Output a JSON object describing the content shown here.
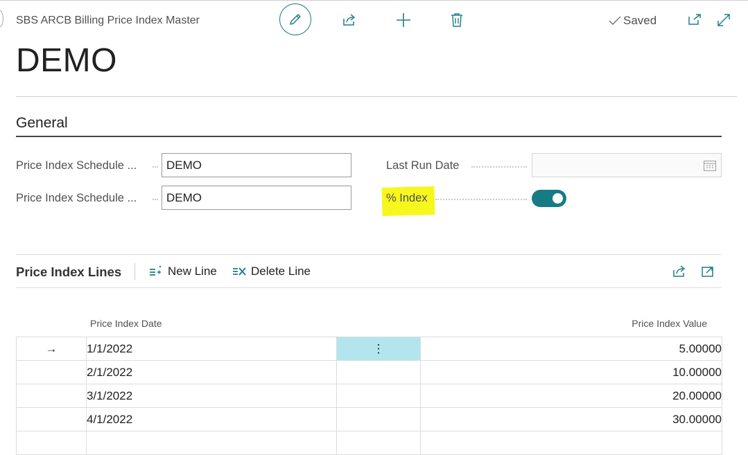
{
  "header": {
    "page_caption": "SBS ARCB Billing Price Index Master",
    "saved_label": "Saved",
    "record_title": "DEMO"
  },
  "general": {
    "section_title": "General",
    "fields": [
      {
        "label": "Price Index Schedule ...",
        "value": "DEMO"
      },
      {
        "label": "Price Index Schedule ...",
        "value": "DEMO"
      }
    ],
    "last_run_date": {
      "label": "Last Run Date",
      "value": ""
    },
    "percent_index": {
      "label": "% Index",
      "value": true
    }
  },
  "lines": {
    "title": "Price Index Lines",
    "new_line_label": "New Line",
    "delete_line_label": "Delete Line",
    "columns": {
      "date": "Price Index Date",
      "value": "Price Index Value"
    },
    "rows": [
      {
        "date": "1/1/2022",
        "value": "5.00000"
      },
      {
        "date": "2/1/2022",
        "value": "10.00000"
      },
      {
        "date": "3/1/2022",
        "value": "20.00000"
      },
      {
        "date": "4/1/2022",
        "value": "30.00000"
      }
    ],
    "row_menu_glyph": "⋮",
    "current_row_glyph": "→"
  },
  "colors": {
    "accent": "#157c86",
    "highlight": "#f7f71e",
    "selected_cell": "#b2e6ec"
  }
}
